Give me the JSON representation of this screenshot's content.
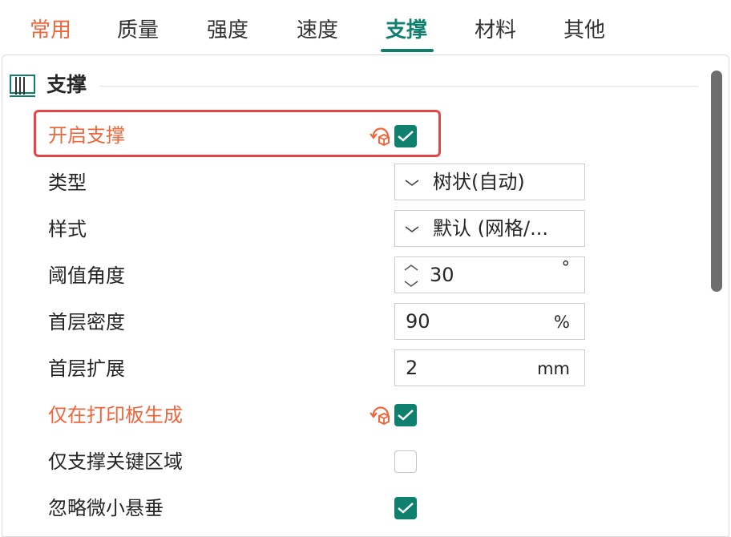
{
  "tabs": [
    {
      "label": "常用"
    },
    {
      "label": "质量"
    },
    {
      "label": "强度"
    },
    {
      "label": "速度"
    },
    {
      "label": "支撑"
    },
    {
      "label": "材料"
    },
    {
      "label": "其他"
    }
  ],
  "section": {
    "title": "支撑",
    "icon": "support-icon"
  },
  "settings": {
    "enable_support": {
      "label": "开启支撑",
      "checked": true,
      "modified": true
    },
    "type": {
      "label": "类型",
      "value": "树状(自动)"
    },
    "style": {
      "label": "样式",
      "value": "默认 (网格/..."
    },
    "threshold_angle": {
      "label": "阈值角度",
      "value": "30",
      "unit": "°"
    },
    "first_layer_density": {
      "label": "首层密度",
      "value": "90",
      "unit": "%"
    },
    "first_layer_expansion": {
      "label": "首层扩展",
      "value": "2",
      "unit": "mm"
    },
    "on_build_plate_only": {
      "label": "仅在打印板生成",
      "checked": true,
      "modified": true
    },
    "critical_regions_only": {
      "label": "仅支撑关键区域",
      "checked": false
    },
    "ignore_small_overhangs": {
      "label": "忽略微小悬垂",
      "checked": true
    }
  },
  "colors": {
    "accent_green": "#0f7f6e",
    "modified_orange": "#f0653a",
    "highlight_red": "#e64545"
  }
}
